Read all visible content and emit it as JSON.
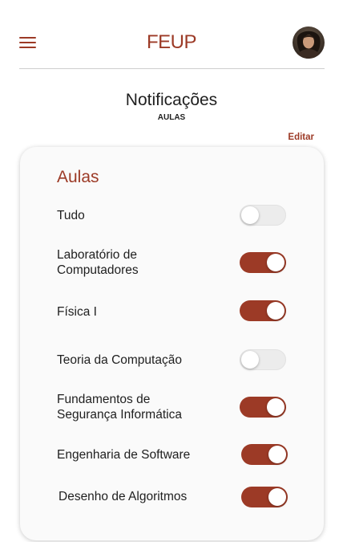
{
  "header": {
    "logo": "FEUP",
    "menu_icon": "hamburger-menu-icon",
    "avatar_icon": "user-avatar"
  },
  "page": {
    "title": "Notificações",
    "subtitle": "AULAS",
    "edit_label": "Editar"
  },
  "card": {
    "title": "Aulas",
    "items": [
      {
        "label": "Tudo",
        "enabled": false
      },
      {
        "label": "Laboratório de Computadores",
        "enabled": true
      },
      {
        "label": "Física I",
        "enabled": true
      },
      {
        "label": "Teoria da Computação",
        "enabled": false
      },
      {
        "label": "Fundamentos de Segurança Informática",
        "enabled": true
      },
      {
        "label": "Engenharia de Software",
        "enabled": true
      },
      {
        "label": "Desenho de Algoritmos",
        "enabled": true
      }
    ]
  },
  "colors": {
    "accent": "#9c3a26",
    "toggle_off": "#ececec",
    "card_background": "#fafafa"
  }
}
